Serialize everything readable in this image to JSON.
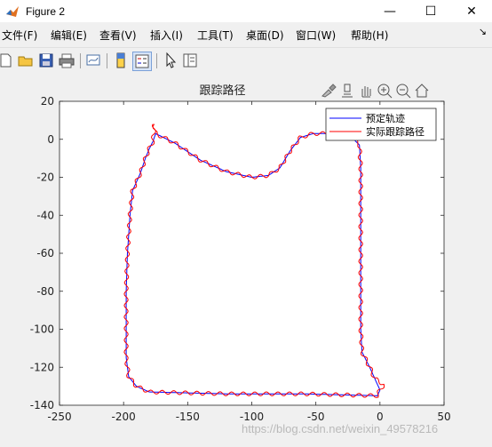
{
  "window": {
    "title": "Figure 2",
    "minimize_glyph": "—",
    "maximize_glyph": "☐",
    "close_glyph": "✕"
  },
  "menu": {
    "items": [
      "文件(F)",
      "编辑(E)",
      "查看(V)",
      "插入(I)",
      "工具(T)",
      "桌面(D)",
      "窗口(W)",
      "帮助(H)"
    ],
    "overflow_glyph": "↘"
  },
  "toolbar": {
    "icons": [
      "new-figure-icon",
      "open-file-icon",
      "save-icon",
      "print-icon",
      "link-plot-icon",
      "colorbar-icon",
      "legend-icon",
      "pointer-icon",
      "property-editor-icon"
    ]
  },
  "axes_toolbar": {
    "icons": [
      "brush-icon",
      "data-cursor-icon",
      "pan-icon",
      "zoom-in-icon",
      "zoom-out-icon",
      "home-icon"
    ]
  },
  "watermark": "https://blog.csdn.net/weixin_49578216",
  "chart_data": {
    "type": "line",
    "title": "跟踪路径",
    "xlabel": "",
    "ylabel": "",
    "xlim": [
      -250,
      50
    ],
    "ylim": [
      -140,
      20
    ],
    "xticks": [
      -250,
      -200,
      -150,
      -100,
      -50,
      0,
      50
    ],
    "yticks": [
      20,
      0,
      -20,
      -40,
      -60,
      -80,
      -100,
      -120,
      -140
    ],
    "grid": false,
    "legend_position": "top-right",
    "colors": {
      "planned": "#0000ff",
      "actual": "#ff0000"
    },
    "series": [
      {
        "name": "预定轨迹",
        "color": "#0000ff",
        "points": [
          [
            -175,
            3
          ],
          [
            -160,
            -2
          ],
          [
            -140,
            -11
          ],
          [
            -120,
            -17
          ],
          [
            -100,
            -20
          ],
          [
            -87,
            -19
          ],
          [
            -78,
            -15
          ],
          [
            -70,
            -6
          ],
          [
            -62,
            1
          ],
          [
            -52,
            3
          ],
          [
            -35,
            3
          ],
          [
            -22,
            1
          ],
          [
            -16,
            -3
          ],
          [
            -15,
            -15
          ],
          [
            -15,
            -40
          ],
          [
            -15,
            -70
          ],
          [
            -15,
            -100
          ],
          [
            -14,
            -112
          ],
          [
            -8,
            -120
          ],
          [
            -4,
            -126
          ],
          [
            0,
            -132
          ],
          [
            -2,
            -135
          ],
          [
            -60,
            -134
          ],
          [
            -120,
            -134
          ],
          [
            -180,
            -133
          ],
          [
            -190,
            -130
          ],
          [
            -196,
            -125
          ],
          [
            -198,
            -115
          ],
          [
            -198,
            -100
          ],
          [
            -198,
            -80
          ],
          [
            -197,
            -60
          ],
          [
            -195,
            -40
          ],
          [
            -193,
            -27
          ],
          [
            -187,
            -18
          ],
          [
            -183,
            -10
          ],
          [
            -180,
            -5
          ],
          [
            -177,
            -1
          ],
          [
            -175,
            3
          ]
        ]
      },
      {
        "name": "实际跟踪路径",
        "color": "#ff0000",
        "wobble": true,
        "points": [
          [
            -176,
            8
          ],
          [
            -175,
            3
          ],
          [
            -160,
            -2
          ],
          [
            -140,
            -11
          ],
          [
            -120,
            -17
          ],
          [
            -100,
            -20
          ],
          [
            -87,
            -19
          ],
          [
            -78,
            -15
          ],
          [
            -70,
            -6
          ],
          [
            -62,
            1
          ],
          [
            -52,
            3
          ],
          [
            -35,
            3
          ],
          [
            -22,
            1
          ],
          [
            -16,
            -3
          ],
          [
            -15,
            -15
          ],
          [
            -15,
            -40
          ],
          [
            -15,
            -70
          ],
          [
            -15,
            -100
          ],
          [
            -14,
            -112
          ],
          [
            -8,
            -120
          ],
          [
            -4,
            -126
          ],
          [
            3,
            -129
          ],
          [
            0,
            -132
          ],
          [
            -2,
            -135
          ],
          [
            -60,
            -134
          ],
          [
            -120,
            -134
          ],
          [
            -180,
            -133
          ],
          [
            -190,
            -130
          ],
          [
            -196,
            -125
          ],
          [
            -198,
            -115
          ],
          [
            -198,
            -100
          ],
          [
            -198,
            -80
          ],
          [
            -197,
            -60
          ],
          [
            -195,
            -40
          ],
          [
            -193,
            -27
          ],
          [
            -187,
            -18
          ],
          [
            -183,
            -10
          ],
          [
            -180,
            -5
          ],
          [
            -177,
            -1
          ],
          [
            -176,
            8
          ]
        ]
      }
    ]
  }
}
